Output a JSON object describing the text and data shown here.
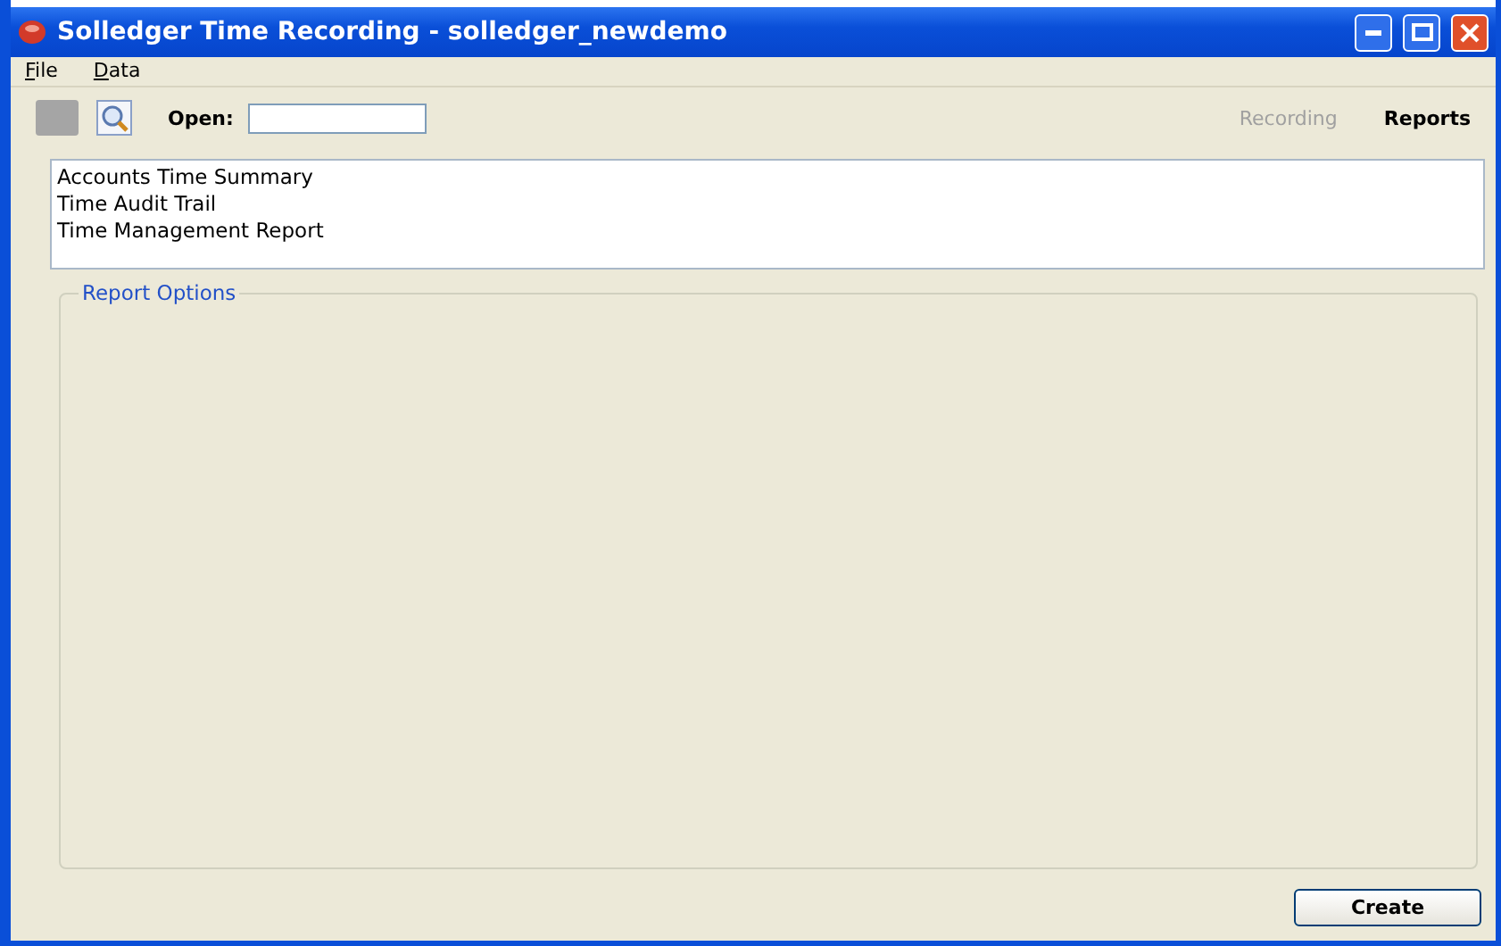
{
  "window": {
    "title": "Solledger Time Recording - solledger_newdemo"
  },
  "menu": [
    {
      "label": "File"
    },
    {
      "label": "Data"
    }
  ],
  "toolbar": {
    "open_label": "Open:"
  },
  "modes": [
    {
      "label": "Recording",
      "selected": false
    },
    {
      "label": "Reports",
      "selected": true
    }
  ],
  "reports": [
    {
      "label": "Accounts Time Summary",
      "selected": false
    },
    {
      "label": "Time Audit Trail",
      "selected": false
    },
    {
      "label": "Time Management Report",
      "selected": false
    }
  ],
  "report_options": {
    "title": "Report Options"
  },
  "buttons": [
    {
      "label": "Create"
    }
  ]
}
